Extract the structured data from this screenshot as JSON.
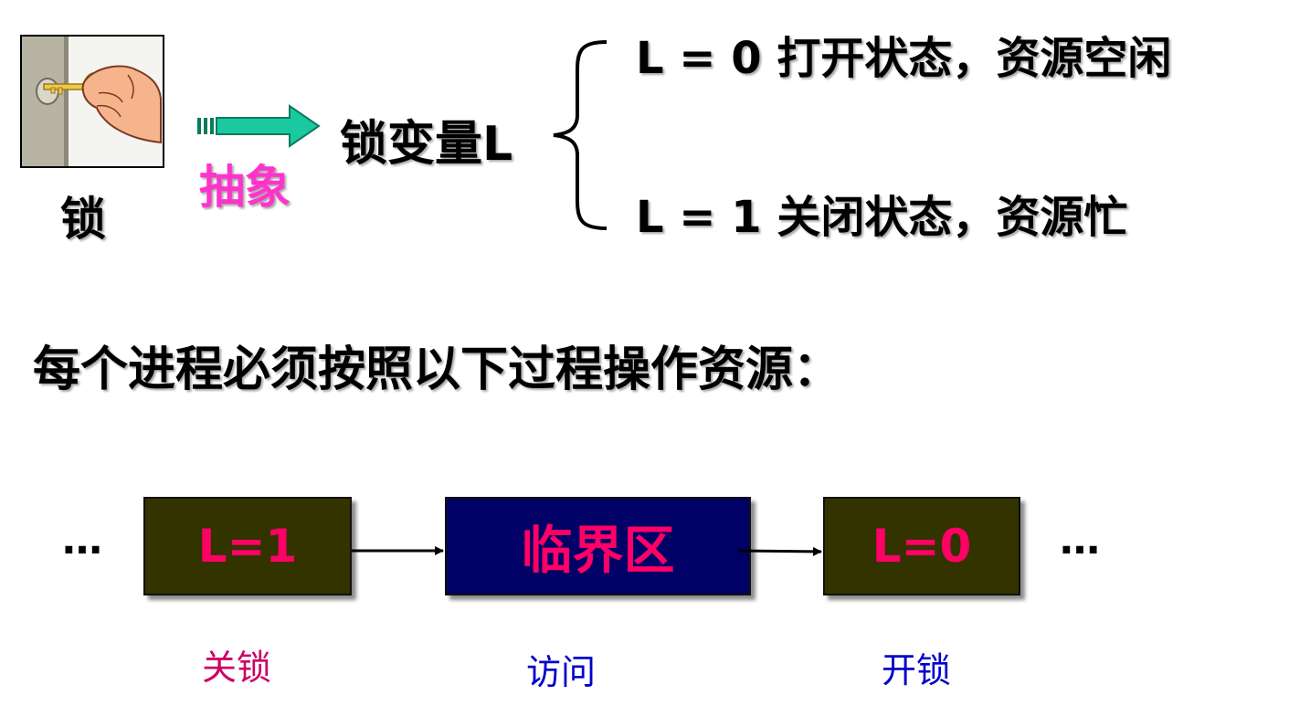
{
  "header": {
    "lock_label": "锁",
    "abstract_label": "抽象",
    "lock_variable": "锁变量L",
    "state_open": "L = 0 打开状态，资源空闲",
    "state_closed": "L = 1 关闭状态，资源忙"
  },
  "instruction": "每个进程必须按照以下过程操作资源：",
  "flow": {
    "ellipsis_left": "…",
    "ellipsis_right": "…",
    "steps": [
      {
        "box_text": "L=1",
        "caption": "关锁"
      },
      {
        "box_text": "临界区",
        "caption": "访问"
      },
      {
        "box_text": "L=0",
        "caption": "开锁"
      }
    ]
  },
  "colors": {
    "arrow_green": "#1bc9a0",
    "abstract_pink": "#ff33cc",
    "box_olive": "#333300",
    "box_navy": "#000066",
    "box_text": "#ff0066",
    "caption_magenta": "#cc0066",
    "caption_blue": "#0000cc"
  }
}
